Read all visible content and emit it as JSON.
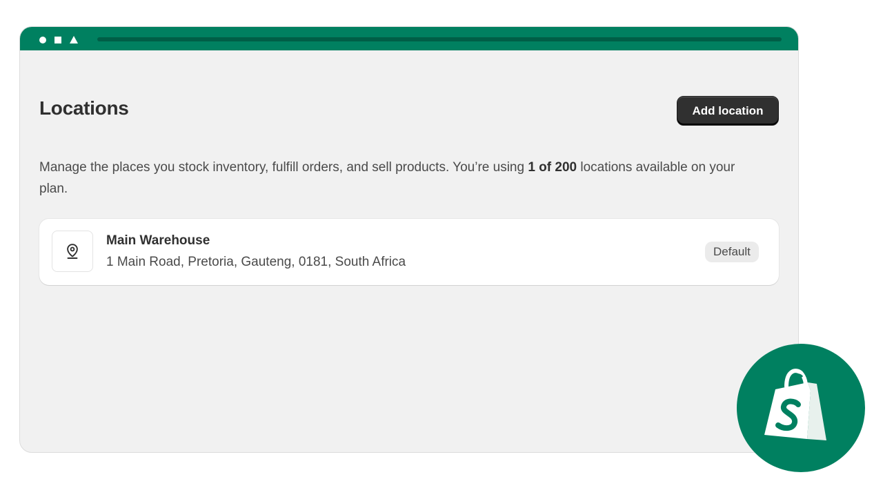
{
  "window": {
    "accent_color": "#008060",
    "controls": [
      "circle",
      "square",
      "triangle"
    ]
  },
  "header": {
    "title": "Locations",
    "add_button_label": "Add location"
  },
  "description": {
    "text_before": "Manage the places you stock inventory, fulfill orders, and sell products. You’re using ",
    "highlight": "1 of 200",
    "text_after": " locations available on your plan."
  },
  "locations": [
    {
      "name": "Main Warehouse",
      "address": "1 Main Road, Pretoria, Gauteng, 0181, South Africa",
      "badge": "Default",
      "icon": "location-pin-icon"
    }
  ],
  "logo": {
    "icon": "shopify-logo",
    "background_color": "#008060"
  }
}
